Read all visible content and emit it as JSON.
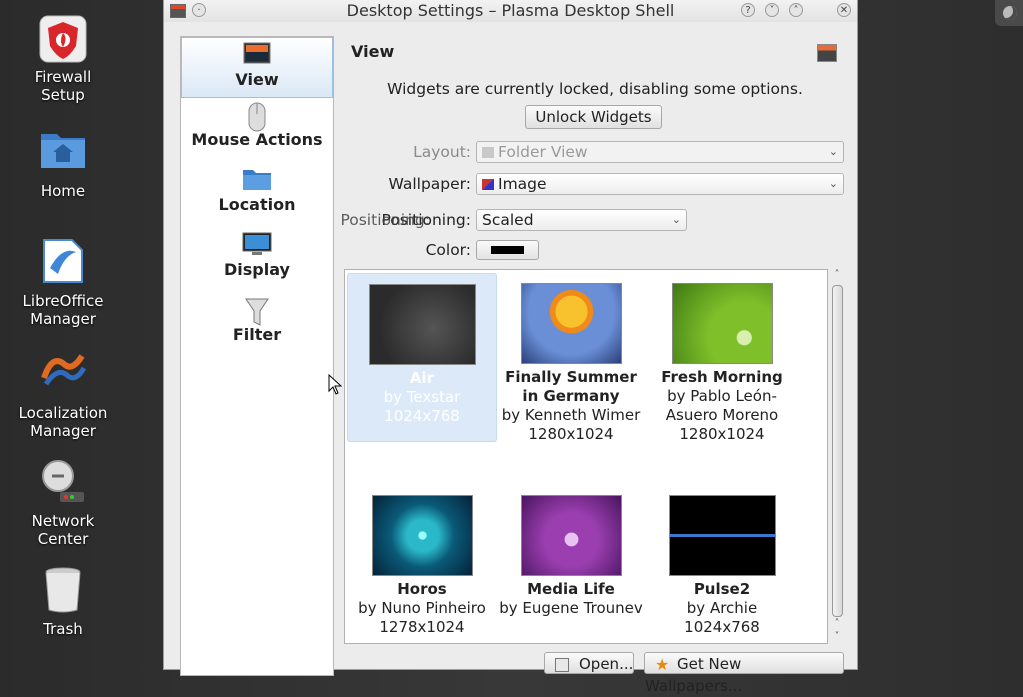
{
  "desktop": {
    "icons": [
      {
        "label": "Firewall Setup",
        "name": "firewall-setup-icon"
      },
      {
        "label": "Home",
        "name": "home-folder-icon"
      },
      {
        "label": "LibreOffice Manager",
        "name": "libreoffice-icon"
      },
      {
        "label": "Localization Manager",
        "name": "localization-icon"
      },
      {
        "label": "Network Center",
        "name": "network-center-icon"
      },
      {
        "label": "Trash",
        "name": "trash-icon"
      }
    ]
  },
  "window": {
    "title": "Desktop Settings – Plasma Desktop Shell",
    "buttons": {
      "help": "?",
      "minimize": "˅",
      "maximize": "˄",
      "close": "✕"
    }
  },
  "sidebar": {
    "items": [
      {
        "label": "View",
        "icon": "view-icon",
        "active": true
      },
      {
        "label": "Mouse Actions",
        "icon": "mouse-icon"
      },
      {
        "label": "Location",
        "icon": "folder-icon"
      },
      {
        "label": "Display",
        "icon": "monitor-icon"
      },
      {
        "label": "Filter",
        "icon": "funnel-icon"
      }
    ]
  },
  "content": {
    "title": "View",
    "notice": "Widgets are currently locked, disabling some options.",
    "unlock_button": "Unlock Widgets",
    "layout": {
      "label": "Layout:",
      "value": "Folder View"
    },
    "wallpaper": {
      "label": "Wallpaper:",
      "value": "Image"
    },
    "positioning": {
      "label": "Positioning:",
      "label_overlap": "Positioning:",
      "value": "Scaled"
    },
    "color": {
      "label": "Color:",
      "value": "#000000"
    },
    "wallpapers": [
      {
        "name": "Air",
        "author": "by Texstar",
        "size": "1024x768",
        "selected": true
      },
      {
        "name": "Finally Summer in Germany",
        "author": "by Kenneth Wimer",
        "size": "1280x1024"
      },
      {
        "name": "Fresh Morning",
        "author": "by Pablo León-Asuero Moreno",
        "size": "1280x1024"
      },
      {
        "name": "Horos",
        "author": "by Nuno Pinheiro",
        "size": "1278x1024"
      },
      {
        "name": "Media Life",
        "author": "by Eugene Trounev",
        "size": ""
      },
      {
        "name": "Pulse2",
        "author": "by Archie",
        "size": "1024x768"
      }
    ],
    "open_button": "Open...",
    "get_new_button": "Get New Wallpapers..."
  }
}
